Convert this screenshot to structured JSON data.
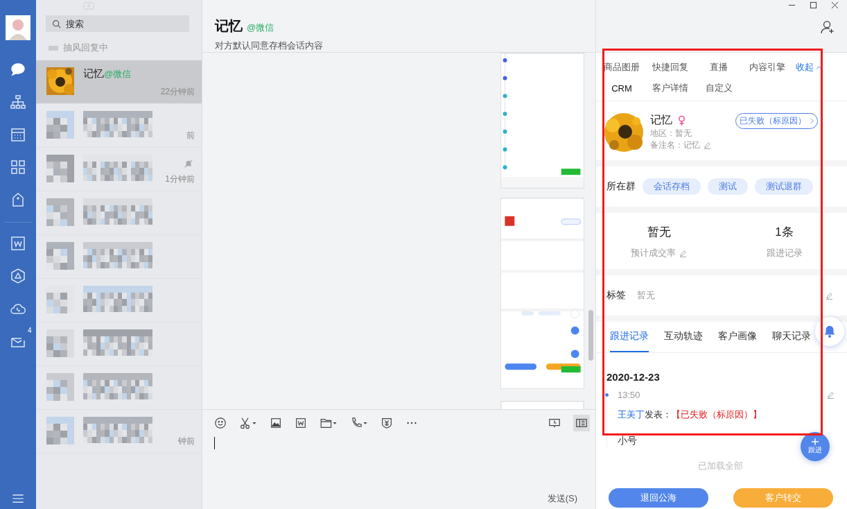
{
  "nav": {
    "items": [
      {
        "kind": "chat",
        "selected": true
      },
      {
        "kind": "org",
        "selected": false
      },
      {
        "kind": "calendar",
        "selected": false
      },
      {
        "kind": "apps",
        "selected": false
      },
      {
        "kind": "house",
        "selected": false
      },
      {
        "kind": "doc",
        "selected": false
      },
      {
        "kind": "cube",
        "selected": false
      },
      {
        "kind": "cloud",
        "selected": false
      },
      {
        "kind": "mail",
        "selected": false,
        "badge": "4"
      }
    ]
  },
  "chat_list": {
    "search": {
      "placeholder": "搜索"
    },
    "typing_status": "抽风回复中",
    "conversations": [
      {
        "kind": "contact",
        "name": "记忆",
        "source": "@微信",
        "time": "22分钟前",
        "selected": true
      },
      {
        "kind": "blurred",
        "time": "前",
        "muted": false,
        "selected": false
      },
      {
        "kind": "blurred",
        "time": "1分钟前",
        "muted": true,
        "selected": false
      },
      {
        "kind": "blurred",
        "muted": false,
        "selected": false
      },
      {
        "kind": "blurred",
        "muted": false,
        "selected": false
      },
      {
        "kind": "blurred",
        "muted": false,
        "selected": false
      },
      {
        "kind": "blurred",
        "muted": false,
        "selected": false
      },
      {
        "kind": "blurred",
        "muted": false,
        "selected": false
      },
      {
        "kind": "blurred",
        "time": "钟前",
        "muted": false,
        "selected": false
      }
    ]
  },
  "conversation": {
    "title": "记忆",
    "source": "@微信",
    "subtitle": "对方默认同意存档会话内容",
    "send_label": "发送(S)"
  },
  "crm_panel": {
    "tools": [
      {
        "label": "商品图册",
        "selected": false
      },
      {
        "label": "快捷回复",
        "selected": false
      },
      {
        "label": "直播",
        "selected": false
      },
      {
        "label": "内容引擎",
        "selected": false
      },
      {
        "label": "CRM",
        "selected": true
      },
      {
        "label": "客户详情",
        "selected": false
      },
      {
        "label": "自定义",
        "selected": false
      }
    ],
    "collapse_label": "收起",
    "customer": {
      "name": "记忆",
      "female": true,
      "region": "地区：暂无",
      "remark": "备注名：记忆",
      "status": "已失败（标原因）"
    },
    "groups_label": "所在群",
    "groups": [
      "会话存档",
      "测试",
      "测试退群"
    ],
    "stats": [
      {
        "value": "暂无",
        "label": "预计成交率",
        "editable": true
      },
      {
        "value": "1条",
        "label": "跟进记录",
        "editable": false
      }
    ],
    "tags_label": "标签",
    "tags_value": "暂无",
    "tabs": [
      {
        "label": "跟进记录",
        "selected": true
      },
      {
        "label": "互动轨迹",
        "selected": false
      },
      {
        "label": "客户画像",
        "selected": false
      },
      {
        "label": "聊天记录",
        "selected": false
      }
    ],
    "record": {
      "date": "2020-12-23",
      "time": "13:50",
      "author": "王美丁",
      "verb": "发表：",
      "status": "【已失败（标原因）】",
      "note": "小号"
    },
    "loaded_label": "已加载全部",
    "follow_label": "跟进",
    "actions": [
      {
        "label": "退回公海",
        "kind": "primary"
      },
      {
        "label": "客户转交",
        "kind": "warning"
      }
    ]
  }
}
